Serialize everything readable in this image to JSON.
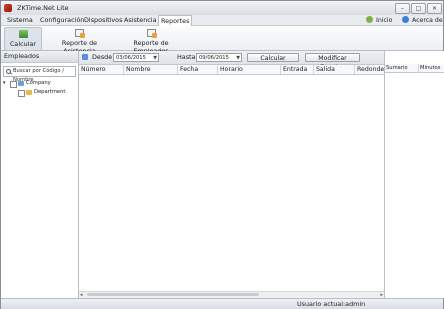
{
  "window": {
    "title": "ZKTime.Net Lite"
  },
  "menubar": {
    "items": [
      "Sistema",
      "Configuración",
      "Dispositivos",
      "Asistencia",
      "Reportes"
    ],
    "active_index": 4,
    "right_links": [
      {
        "label": "Inicio",
        "icon": "home-icon",
        "color": "#7cb342"
      },
      {
        "label": "Acerca de",
        "icon": "info-icon",
        "color": "#3d7fd6"
      }
    ]
  },
  "ribbon": {
    "buttons": [
      {
        "label": "Calcular",
        "icon": "calculator-icon",
        "selected": true
      },
      {
        "label": "Reporte de Asistencia",
        "icon": "attendance-report-icon",
        "selected": false
      },
      {
        "label": "Reporte de Empleados",
        "icon": "employee-report-icon",
        "selected": false
      }
    ]
  },
  "employees_panel": {
    "title": "Empleados",
    "search_placeholder": "Buscar por Código / Nombre",
    "tree": [
      {
        "label": "Company",
        "level": 0,
        "expanded": true
      },
      {
        "label": "Department",
        "level": 1,
        "expanded": false
      }
    ]
  },
  "filters": {
    "from_label": "Desde",
    "from_value": "03/06/2015",
    "to_label": "Hasta",
    "to_value": "09/06/2015",
    "calculate_button": "Calcular",
    "modify_button": "Modificar Eventos"
  },
  "grid": {
    "columns": [
      "Número",
      "Nombre",
      "Fecha",
      "Horario",
      "Entrada",
      "Salida",
      "Redondeo"
    ],
    "rows": []
  },
  "summary_grid": {
    "columns": [
      "Sumario",
      "Minutos"
    ]
  },
  "status": {
    "text": "Usuario actual:admin"
  }
}
